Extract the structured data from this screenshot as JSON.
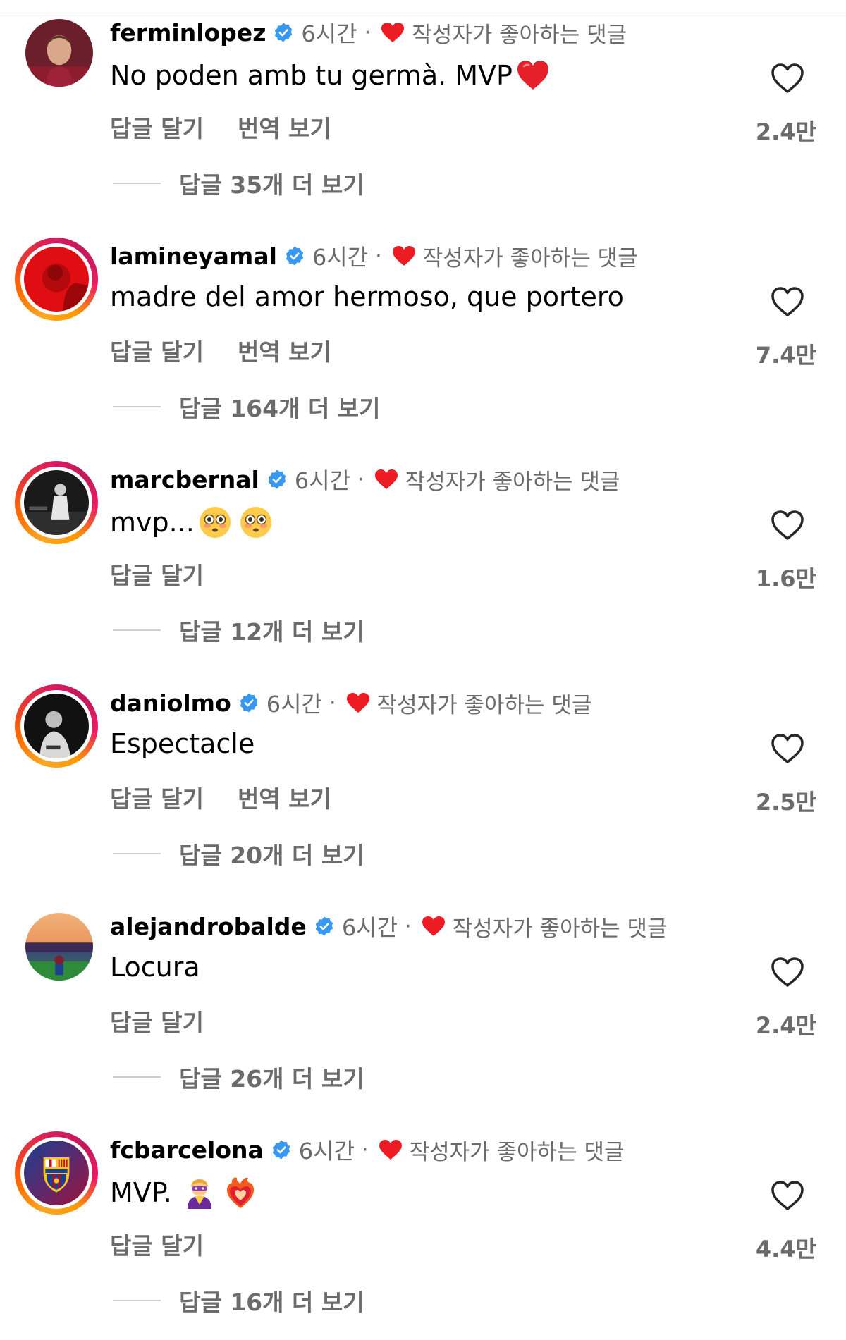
{
  "strings": {
    "time": "6시간",
    "dot": "·",
    "liked_by_author": "작성자가 좋아하는 댓글",
    "reply": "답글 달기",
    "translate": "번역 보기"
  },
  "colors": {
    "verified": "#3897f0",
    "liked_heart": "#ed1c24",
    "secondary_text": "#6b6b6b"
  },
  "comments": [
    {
      "username": "ferminlopez",
      "text": "No poden amb tu germà. MVP",
      "emojis": [
        "red-heart-emoji"
      ],
      "likes": "2.4만",
      "has_translate": true,
      "more_replies": "답글 35개 더 보기",
      "story_ring": false
    },
    {
      "username": "lamineyamal",
      "text": "madre del amor hermoso, que portero",
      "emojis": [],
      "likes": "7.4만",
      "has_translate": true,
      "more_replies": "답글 164개 더 보기",
      "story_ring": true
    },
    {
      "username": "marcbernal",
      "text": "mvp...",
      "emojis": [
        "flushed-face-emoji",
        "flushed-face-emoji"
      ],
      "likes": "1.6만",
      "has_translate": false,
      "more_replies": "답글 12개 더 보기",
      "story_ring": true
    },
    {
      "username": "daniolmo",
      "text": "Espectacle",
      "emojis": [],
      "likes": "2.5만",
      "has_translate": true,
      "more_replies": "답글 20개 더 보기",
      "story_ring": true
    },
    {
      "username": "alejandrobalde",
      "text": "Locura",
      "emojis": [],
      "likes": "2.4만",
      "has_translate": false,
      "more_replies": "답글 26개 더 보기",
      "story_ring": false
    },
    {
      "username": "fcbarcelona",
      "text": "MVP.",
      "emojis": [
        "superhero-emoji",
        "heart-on-fire-emoji"
      ],
      "likes": "4.4만",
      "has_translate": false,
      "more_replies": "답글 16개 더 보기",
      "story_ring": true
    }
  ]
}
